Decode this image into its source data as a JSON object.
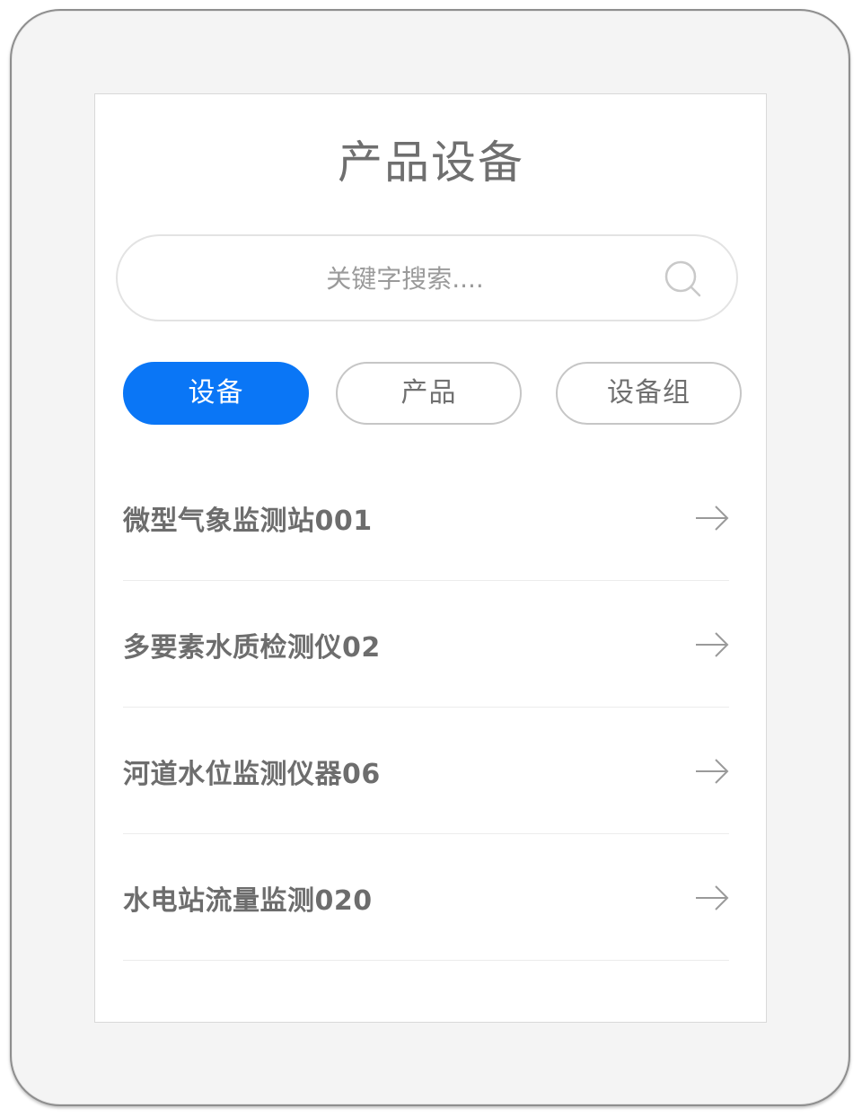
{
  "page": {
    "title": "产品设备"
  },
  "search": {
    "placeholder": "关键字搜索...."
  },
  "tabs": [
    {
      "label": "设备",
      "active": true
    },
    {
      "label": "产品",
      "active": false
    },
    {
      "label": "设备组",
      "active": false
    }
  ],
  "devices": [
    {
      "name": "微型气象监测站001"
    },
    {
      "name": "多要素水质检测仪02"
    },
    {
      "name": "河道水位监测仪器06"
    },
    {
      "name": "水电站流量监测020"
    }
  ],
  "icons": {
    "search": "search-icon",
    "arrow": "arrow-right-icon"
  },
  "colors": {
    "accent": "#0a76f6",
    "text": "#6d6d6d",
    "border": "#c6c6c6"
  }
}
